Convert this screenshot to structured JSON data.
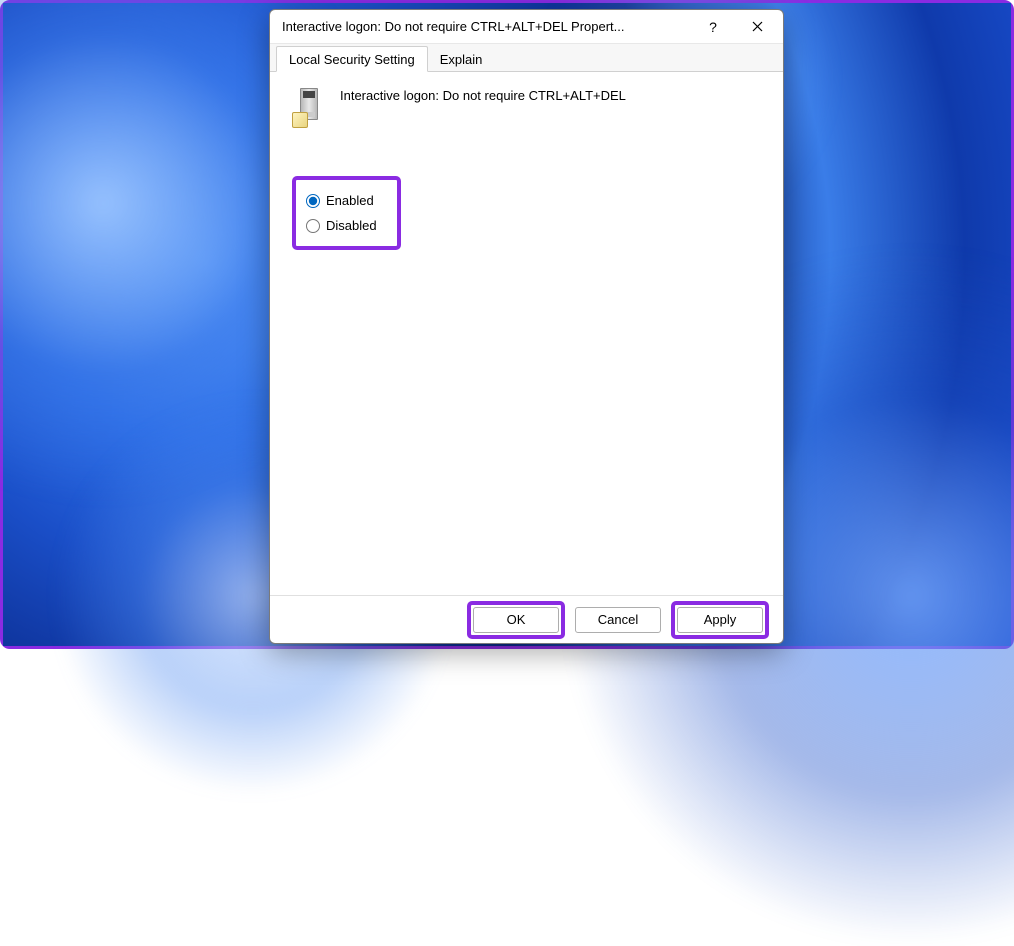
{
  "titlebar": {
    "title": "Interactive logon: Do not require CTRL+ALT+DEL Propert...",
    "help_label": "?",
    "close_label": "✕"
  },
  "tabs": {
    "security": "Local Security Setting",
    "explain": "Explain"
  },
  "content": {
    "policy_name": "Interactive logon: Do not require CTRL+ALT+DEL",
    "icon_name": "server-policy-icon"
  },
  "radios": {
    "enabled": "Enabled",
    "disabled": "Disabled",
    "selected": "enabled"
  },
  "buttons": {
    "ok": "OK",
    "cancel": "Cancel",
    "apply": "Apply"
  },
  "highlight_color": "#8a2be2"
}
